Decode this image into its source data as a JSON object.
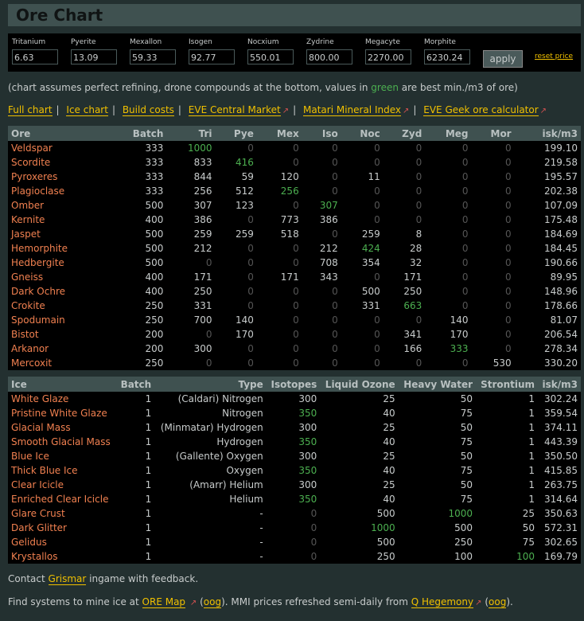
{
  "title": "Ore Chart",
  "prices": [
    {
      "label": "Tritanium",
      "value": "6.63"
    },
    {
      "label": "Pyerite",
      "value": "13.09"
    },
    {
      "label": "Mexallon",
      "value": "59.33"
    },
    {
      "label": "Isogen",
      "value": "92.77"
    },
    {
      "label": "Nocxium",
      "value": "550.01"
    },
    {
      "label": "Zydrine",
      "value": "800.00"
    },
    {
      "label": "Megacyte",
      "value": "2270.00"
    },
    {
      "label": "Morphite",
      "value": "6230.24"
    }
  ],
  "apply_label": "apply",
  "reset_label": "reset price",
  "note": {
    "before": "(chart assumes perfect refining, drone compounds at the bottom, values in ",
    "green": "green",
    "after": " are best min./m3 of ore)"
  },
  "links": [
    "Full chart",
    "Ice chart",
    "Build costs",
    "EVE Central Market",
    "Matari Mineral Index",
    "EVE Geek ore calculator"
  ],
  "ore_table": {
    "headers": [
      "Ore",
      "Batch",
      "Tri",
      "Pye",
      "Mex",
      "Iso",
      "Noc",
      "Zyd",
      "Meg",
      "Mor",
      "isk/m3"
    ],
    "rows": [
      {
        "name": "Veldspar",
        "batch": "333",
        "values": [
          "1000",
          "0",
          "0",
          "0",
          "0",
          "0",
          "0",
          "0"
        ],
        "isk": "199.10",
        "best": [
          0
        ]
      },
      {
        "name": "Scordite",
        "batch": "333",
        "values": [
          "833",
          "416",
          "0",
          "0",
          "0",
          "0",
          "0",
          "0"
        ],
        "isk": "219.58",
        "best": [
          1
        ]
      },
      {
        "name": "Pyroxeres",
        "batch": "333",
        "values": [
          "844",
          "59",
          "120",
          "0",
          "11",
          "0",
          "0",
          "0"
        ],
        "isk": "195.57",
        "best": []
      },
      {
        "name": "Plagioclase",
        "batch": "333",
        "values": [
          "256",
          "512",
          "256",
          "0",
          "0",
          "0",
          "0",
          "0"
        ],
        "isk": "202.38",
        "best": [
          2
        ]
      },
      {
        "name": "Omber",
        "batch": "500",
        "values": [
          "307",
          "123",
          "0",
          "307",
          "0",
          "0",
          "0",
          "0"
        ],
        "isk": "107.09",
        "best": [
          3
        ]
      },
      {
        "name": "Kernite",
        "batch": "400",
        "values": [
          "386",
          "0",
          "773",
          "386",
          "0",
          "0",
          "0",
          "0"
        ],
        "isk": "175.48",
        "best": []
      },
      {
        "name": "Jaspet",
        "batch": "500",
        "values": [
          "259",
          "259",
          "518",
          "0",
          "259",
          "8",
          "0",
          "0"
        ],
        "isk": "184.69",
        "best": []
      },
      {
        "name": "Hemorphite",
        "batch": "500",
        "values": [
          "212",
          "0",
          "0",
          "212",
          "424",
          "28",
          "0",
          "0"
        ],
        "isk": "184.45",
        "best": [
          4
        ]
      },
      {
        "name": "Hedbergite",
        "batch": "500",
        "values": [
          "0",
          "0",
          "0",
          "708",
          "354",
          "32",
          "0",
          "0"
        ],
        "isk": "190.66",
        "best": []
      },
      {
        "name": "Gneiss",
        "batch": "400",
        "values": [
          "171",
          "0",
          "171",
          "343",
          "0",
          "171",
          "0",
          "0"
        ],
        "isk": "89.95",
        "best": []
      },
      {
        "name": "Dark Ochre",
        "batch": "400",
        "values": [
          "250",
          "0",
          "0",
          "0",
          "500",
          "250",
          "0",
          "0"
        ],
        "isk": "148.96",
        "best": []
      },
      {
        "name": "Crokite",
        "batch": "250",
        "values": [
          "331",
          "0",
          "0",
          "0",
          "331",
          "663",
          "0",
          "0"
        ],
        "isk": "178.66",
        "best": [
          5
        ]
      },
      {
        "name": "Spodumain",
        "batch": "250",
        "values": [
          "700",
          "140",
          "0",
          "0",
          "0",
          "0",
          "140",
          "0"
        ],
        "isk": "81.07",
        "best": []
      },
      {
        "name": "Bistot",
        "batch": "200",
        "values": [
          "0",
          "170",
          "0",
          "0",
          "0",
          "341",
          "170",
          "0"
        ],
        "isk": "206.54",
        "best": []
      },
      {
        "name": "Arkanor",
        "batch": "200",
        "values": [
          "300",
          "0",
          "0",
          "0",
          "0",
          "166",
          "333",
          "0"
        ],
        "isk": "278.34",
        "best": [
          6
        ]
      },
      {
        "name": "Mercoxit",
        "batch": "250",
        "values": [
          "0",
          "0",
          "0",
          "0",
          "0",
          "0",
          "0",
          "530"
        ],
        "isk": "330.20",
        "best": []
      }
    ]
  },
  "ice_table": {
    "headers": [
      "Ice",
      "Batch",
      "Type",
      "Isotopes",
      "Liquid Ozone",
      "Heavy Water",
      "Strontium",
      "isk/m3"
    ],
    "rows": [
      {
        "name": "White Glaze",
        "batch": "1",
        "type": "(Caldari) Nitrogen",
        "values": [
          "300",
          "25",
          "50",
          "1"
        ],
        "isk": "302.24",
        "best": []
      },
      {
        "name": "Pristine White Glaze",
        "batch": "1",
        "type": "Nitrogen",
        "values": [
          "350",
          "40",
          "75",
          "1"
        ],
        "isk": "359.54",
        "best": [
          0
        ]
      },
      {
        "name": "Glacial Mass",
        "batch": "1",
        "type": "(Minmatar) Hydrogen",
        "values": [
          "300",
          "25",
          "50",
          "1"
        ],
        "isk": "374.11",
        "best": []
      },
      {
        "name": "Smooth Glacial Mass",
        "batch": "1",
        "type": "Hydrogen",
        "values": [
          "350",
          "40",
          "75",
          "1"
        ],
        "isk": "443.39",
        "best": [
          0
        ]
      },
      {
        "name": "Blue Ice",
        "batch": "1",
        "type": "(Gallente) Oxygen",
        "values": [
          "300",
          "25",
          "50",
          "1"
        ],
        "isk": "350.50",
        "best": []
      },
      {
        "name": "Thick Blue Ice",
        "batch": "1",
        "type": "Oxygen",
        "values": [
          "350",
          "40",
          "75",
          "1"
        ],
        "isk": "415.85",
        "best": [
          0
        ]
      },
      {
        "name": "Clear Icicle",
        "batch": "1",
        "type": "(Amarr) Helium",
        "values": [
          "300",
          "25",
          "50",
          "1"
        ],
        "isk": "263.75",
        "best": []
      },
      {
        "name": "Enriched Clear Icicle",
        "batch": "1",
        "type": "Helium",
        "values": [
          "350",
          "40",
          "75",
          "1"
        ],
        "isk": "314.64",
        "best": [
          0
        ]
      },
      {
        "name": "Glare Crust",
        "batch": "1",
        "type": "-",
        "values": [
          "0",
          "500",
          "1000",
          "25"
        ],
        "isk": "350.63",
        "best": [
          2
        ]
      },
      {
        "name": "Dark Glitter",
        "batch": "1",
        "type": "-",
        "values": [
          "0",
          "1000",
          "500",
          "50"
        ],
        "isk": "572.31",
        "best": [
          1
        ]
      },
      {
        "name": "Gelidus",
        "batch": "1",
        "type": "-",
        "values": [
          "0",
          "500",
          "250",
          "75"
        ],
        "isk": "302.65",
        "best": []
      },
      {
        "name": "Krystallos",
        "batch": "1",
        "type": "-",
        "values": [
          "0",
          "250",
          "100",
          "100"
        ],
        "isk": "169.79",
        "best": [
          3
        ]
      }
    ]
  },
  "footer": {
    "contact_before": "Contact ",
    "contact_link": "Grismar",
    "contact_after": " ingame with feedback.",
    "find_before": "Find systems to mine ice at ",
    "ore_map": "ORE Map",
    "oog": "oog",
    "mmi_text": ". MMI prices refreshed semi-daily from ",
    "q_hegemony": "Q Hegemony",
    "paren_open": "(",
    "paren_close": ")",
    "end": "."
  },
  "colors": {
    "best": "#4caf50",
    "name": "#f08050",
    "link": "#f0c000",
    "header": "#3f5150"
  }
}
